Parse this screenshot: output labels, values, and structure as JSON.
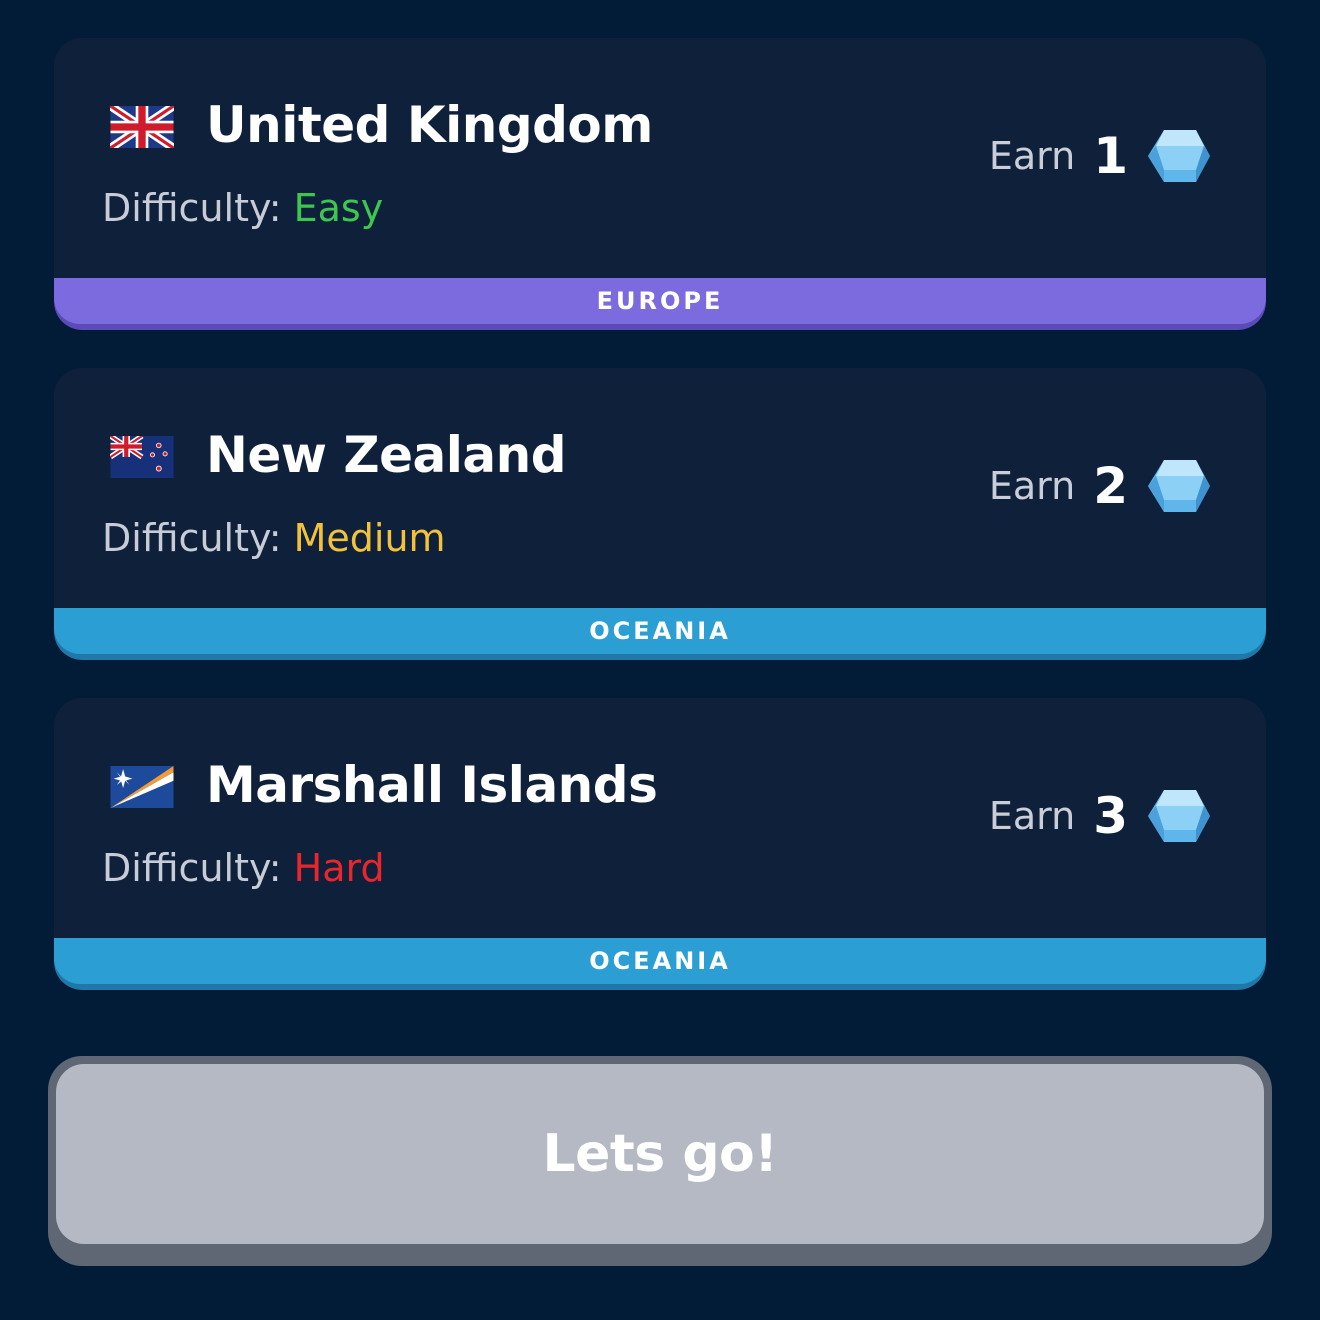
{
  "challenges": [
    {
      "country": "United Kingdom",
      "flag_icon": "uk-flag-icon",
      "difficulty_label": "Difficulty:",
      "difficulty_value": "Easy",
      "difficulty_color": "#3dc751",
      "earn_label": "Earn",
      "earn_amount": "1",
      "gem_icon": "gem-icon",
      "region": "EUROPE",
      "region_color": "#7b6bdf",
      "region_shadow_color": "#5b4bb8"
    },
    {
      "country": "New Zealand",
      "flag_icon": "nz-flag-icon",
      "difficulty_label": "Difficulty:",
      "difficulty_value": "Medium",
      "difficulty_color": "#f2c23a",
      "earn_label": "Earn",
      "earn_amount": "2",
      "gem_icon": "gem-icon",
      "region": "OCEANIA",
      "region_color": "#2b9fd4",
      "region_shadow_color": "#1f78a8"
    },
    {
      "country": "Marshall Islands",
      "flag_icon": "marshall-islands-flag-icon",
      "difficulty_label": "Difficulty:",
      "difficulty_value": "Hard",
      "difficulty_color": "#e8262b",
      "earn_label": "Earn",
      "earn_amount": "3",
      "gem_icon": "gem-icon",
      "region": "OCEANIA",
      "region_color": "#2b9fd4",
      "region_shadow_color": "#1f78a8"
    }
  ],
  "start_button": {
    "label": "Lets go!"
  },
  "colors": {
    "background": "#021c38",
    "card": "#0f203b",
    "button_face": "#b4b9c4",
    "button_edge": "#5f6775"
  }
}
